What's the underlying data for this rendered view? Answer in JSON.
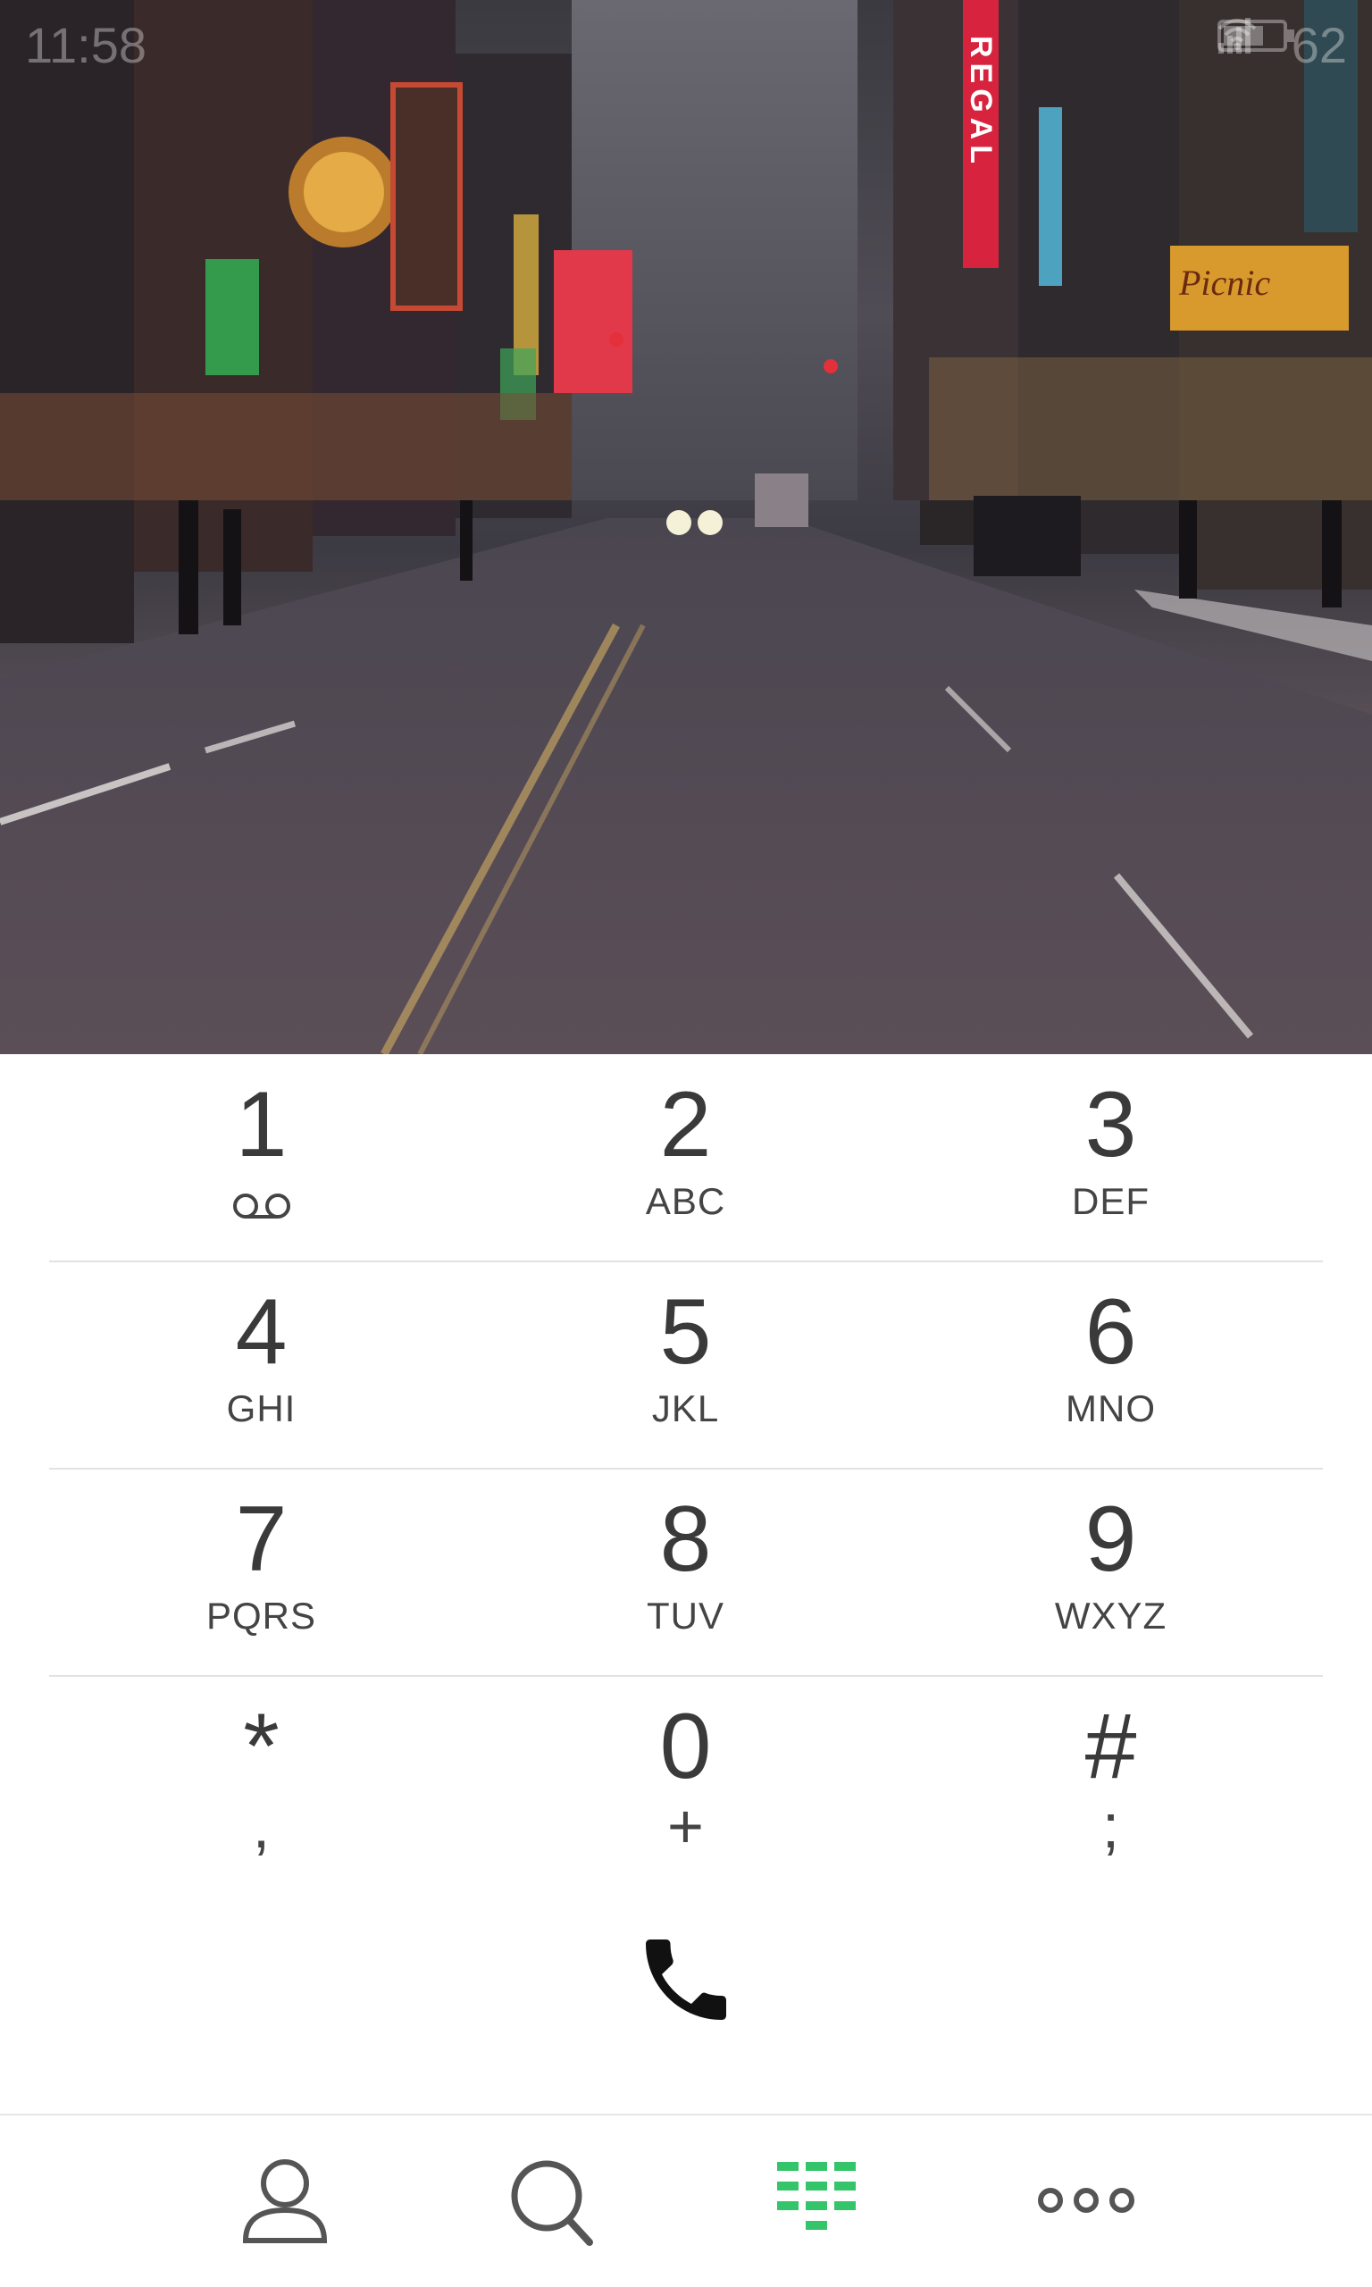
{
  "status_bar": {
    "time": "11:58",
    "battery": "62"
  },
  "hero": {
    "sign_regal": "REGAL",
    "sign_picnic": "Picnic"
  },
  "keypad": {
    "keys": [
      {
        "digit": "1",
        "sub": ""
      },
      {
        "digit": "2",
        "sub": "ABC"
      },
      {
        "digit": "3",
        "sub": "DEF"
      },
      {
        "digit": "4",
        "sub": "GHI"
      },
      {
        "digit": "5",
        "sub": "JKL"
      },
      {
        "digit": "6",
        "sub": "MNO"
      },
      {
        "digit": "7",
        "sub": "PQRS"
      },
      {
        "digit": "8",
        "sub": "TUV"
      },
      {
        "digit": "9",
        "sub": "WXYZ"
      },
      {
        "digit": "*",
        "sub": ","
      },
      {
        "digit": "0",
        "sub": "+"
      },
      {
        "digit": "#",
        "sub": ";"
      }
    ]
  },
  "bottom_nav": {
    "items": [
      {
        "icon": "person-icon"
      },
      {
        "icon": "search-icon"
      },
      {
        "icon": "dialpad-icon",
        "active": true
      },
      {
        "icon": "more-icon"
      }
    ],
    "accent_color": "#34c46a"
  }
}
